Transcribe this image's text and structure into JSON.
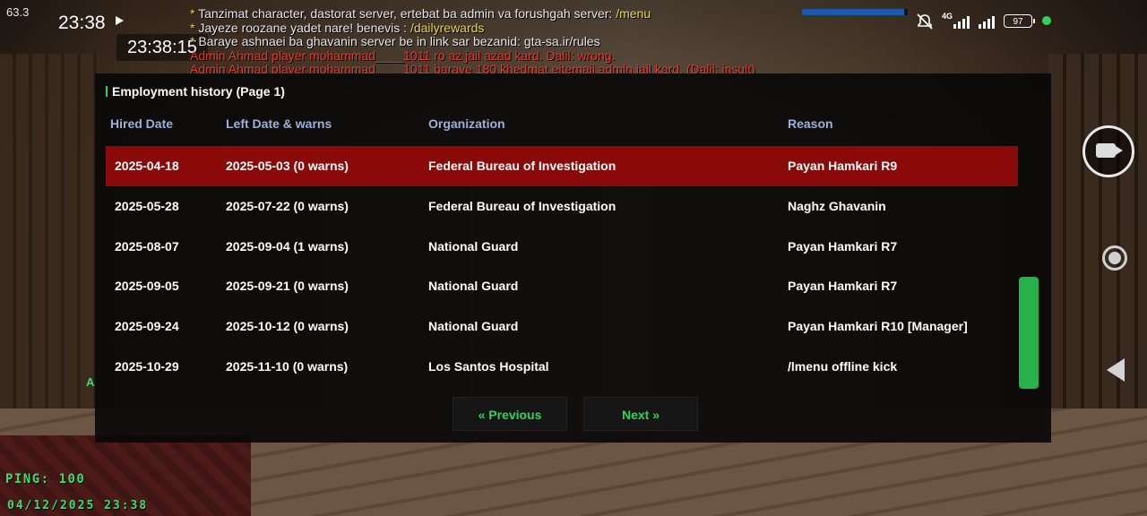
{
  "statusbar": {
    "fps": "63.3",
    "time": "23:38",
    "network": "4G",
    "battery": "97",
    "progress_fraction": 0.97
  },
  "game_clock": "23:38:15",
  "chat": [
    {
      "prefix": "* ",
      "text": "Tanzimat character, dastorat server, ertebat ba admin va forushgah server: ",
      "link": "/menu",
      "color": "#e6e6e6"
    },
    {
      "prefix": "* ",
      "text": "Jayeze roozane yadet nare! benevis : ",
      "link": "/dailyrewards",
      "color": "#e6e6e6"
    },
    {
      "prefix": "* ",
      "text": "Baraye ashnaei ba ghavanin server be in link sar bezanid: gta-sa.ir/rules",
      "link": "",
      "color": "#e6e6e6"
    },
    {
      "prefix": "",
      "text": "Admin Ahmad player mohammad____1011 ro az jail azad kard. Dalil: wrong.",
      "link": "",
      "color": "#e03a2a"
    },
    {
      "prefix": "",
      "text": "Admin Ahmad player mohammad____1011 baraye 180 khedmat ejtemaii admin jail kard. (Dalil: insult)",
      "link": "",
      "color": "#e03a2a"
    }
  ],
  "dialog": {
    "title": "Employment history (Page 1)",
    "columns": [
      "Hired Date",
      "Left Date & warns",
      "Organization",
      "Reason"
    ],
    "rows": [
      {
        "hired": "2025-04-18",
        "left": "2025-05-03 (0 warns)",
        "org": "Federal Bureau of Investigation",
        "reason": "Payan Hamkari R9",
        "selected": true
      },
      {
        "hired": "2025-05-28",
        "left": "2025-07-22 (0 warns)",
        "org": "Federal Bureau of Investigation",
        "reason": "Naghz Ghavanin",
        "selected": false
      },
      {
        "hired": "2025-08-07",
        "left": "2025-09-04 (1 warns)",
        "org": "National Guard",
        "reason": "Payan Hamkari R7",
        "selected": false
      },
      {
        "hired": "2025-09-05",
        "left": "2025-09-21 (0 warns)",
        "org": "National Guard",
        "reason": "Payan Hamkari R7",
        "selected": false
      },
      {
        "hired": "2025-09-24",
        "left": "2025-10-12 (0 warns)",
        "org": "National Guard",
        "reason": "Payan Hamkari R10 [Manager]",
        "selected": false
      },
      {
        "hired": "2025-10-29",
        "left": "2025-11-10 (0 warns)",
        "org": "Los Santos Hospital",
        "reason": "/lmenu offline kick",
        "selected": false
      }
    ],
    "prev_label": "« Previous",
    "next_label": "Next »"
  },
  "hud": {
    "ping": "PING: 100",
    "datetime": "04/12/2025 23:38"
  },
  "colors": {
    "accent_green": "#2fd35a",
    "selected_row": "#8a0a0a",
    "header_text": "#9fb0d8",
    "admin_red": "#e03a2a",
    "chat_link": "#e9d44a"
  },
  "icons": [
    "play-icon",
    "mute-icon",
    "signal-icon",
    "battery-icon",
    "camera-icon",
    "record-icon",
    "back-icon"
  ]
}
